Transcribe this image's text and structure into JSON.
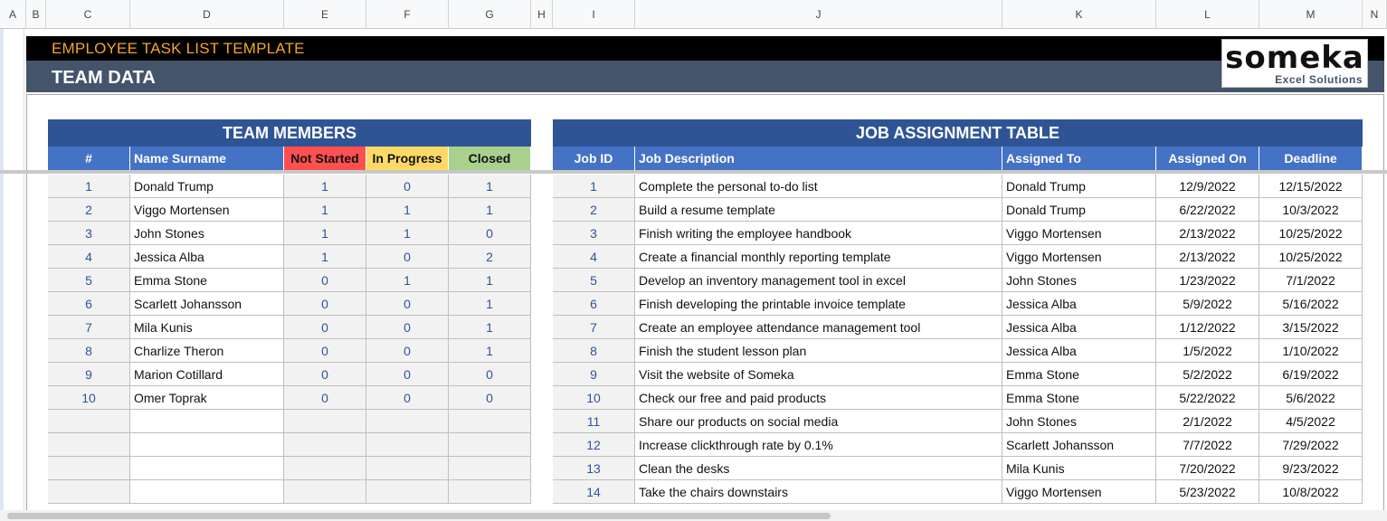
{
  "columns": [
    "A",
    "B",
    "C",
    "D",
    "E",
    "F",
    "G",
    "H",
    "I",
    "J",
    "K",
    "L",
    "M",
    "N"
  ],
  "banner": {
    "title": "EMPLOYEE TASK LIST TEMPLATE",
    "subtitle": "TEAM DATA"
  },
  "logo": {
    "main": "someka",
    "tagline": "Excel Solutions"
  },
  "team_members": {
    "title": "TEAM MEMBERS",
    "headers": [
      "#",
      "Name Surname",
      "Not Started",
      "In Progress",
      "Closed"
    ],
    "rows": [
      [
        "1",
        "Donald Trump",
        "1",
        "0",
        "1"
      ],
      [
        "2",
        "Viggo Mortensen",
        "1",
        "1",
        "1"
      ],
      [
        "3",
        "John Stones",
        "1",
        "1",
        "0"
      ],
      [
        "4",
        "Jessica Alba",
        "1",
        "0",
        "2"
      ],
      [
        "5",
        "Emma Stone",
        "0",
        "1",
        "1"
      ],
      [
        "6",
        "Scarlett Johansson",
        "0",
        "0",
        "1"
      ],
      [
        "7",
        "Mila Kunis",
        "0",
        "0",
        "1"
      ],
      [
        "8",
        "Charlize Theron",
        "0",
        "0",
        "1"
      ],
      [
        "9",
        "Marion Cotillard",
        "0",
        "0",
        "0"
      ],
      [
        "10",
        "Omer Toprak",
        "0",
        "0",
        "0"
      ],
      [
        "",
        "",
        "",
        "",
        ""
      ],
      [
        "",
        "",
        "",
        "",
        ""
      ],
      [
        "",
        "",
        "",
        "",
        ""
      ],
      [
        "",
        "",
        "",
        "",
        ""
      ]
    ]
  },
  "job_assignments": {
    "title": "JOB ASSIGNMENT TABLE",
    "headers": [
      "Job ID",
      "Job Description",
      "Assigned To",
      "Assigned On",
      "Deadline"
    ],
    "rows": [
      [
        "1",
        "Complete the personal to-do list",
        "Donald Trump",
        "12/9/2022",
        "12/15/2022"
      ],
      [
        "2",
        "Build a resume template",
        "Donald Trump",
        "6/22/2022",
        "10/3/2022"
      ],
      [
        "3",
        "Finish writing the employee handbook",
        "Viggo Mortensen",
        "2/13/2022",
        "10/25/2022"
      ],
      [
        "4",
        "Create a financial monthly reporting template",
        "Viggo Mortensen",
        "2/13/2022",
        "10/25/2022"
      ],
      [
        "5",
        "Develop an inventory management tool in excel",
        "John Stones",
        "1/23/2022",
        "7/1/2022"
      ],
      [
        "6",
        "Finish developing the printable invoice template",
        "Jessica Alba",
        "5/9/2022",
        "5/16/2022"
      ],
      [
        "7",
        "Create an employee attendance management tool",
        "Jessica Alba",
        "1/12/2022",
        "3/15/2022"
      ],
      [
        "8",
        "Finish the student lesson plan",
        "Jessica Alba",
        "1/5/2022",
        "1/10/2022"
      ],
      [
        "9",
        "Visit the website of Someka",
        "Emma Stone",
        "5/2/2022",
        "6/19/2022"
      ],
      [
        "10",
        "Check our free and paid products",
        "Emma Stone",
        "5/22/2022",
        "5/6/2022"
      ],
      [
        "11",
        "Share our products on social media",
        "John Stones",
        "2/1/2022",
        "4/5/2022"
      ],
      [
        "12",
        "Increase clickthrough rate by 0.1%",
        "Scarlett Johansson",
        "7/7/2022",
        "7/29/2022"
      ],
      [
        "13",
        "Clean the desks",
        "Mila Kunis",
        "7/20/2022",
        "9/23/2022"
      ],
      [
        "14",
        "Take the chairs downstairs",
        "Viggo Mortensen",
        "5/23/2022",
        "10/8/2022"
      ]
    ]
  }
}
